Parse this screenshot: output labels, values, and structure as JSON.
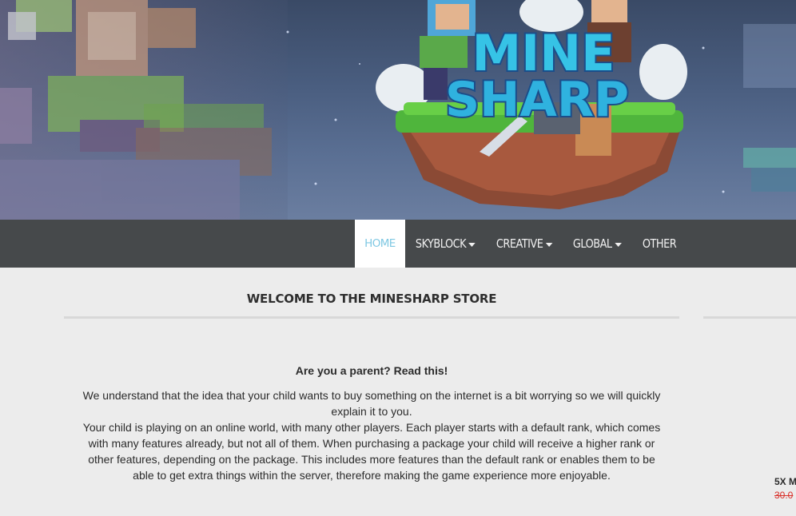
{
  "banner": {
    "logo_line1": "MINE",
    "logo_line2": "SHARP"
  },
  "nav": {
    "items": [
      {
        "label": "HOME",
        "active": true,
        "dropdown": false
      },
      {
        "label": "SKYBLOCK",
        "active": false,
        "dropdown": true
      },
      {
        "label": "CREATIVE",
        "active": false,
        "dropdown": true
      },
      {
        "label": "GLOBAL",
        "active": false,
        "dropdown": true
      },
      {
        "label": "OTHER",
        "active": false,
        "dropdown": false
      }
    ]
  },
  "main": {
    "title": "WELCOME TO THE MINESHARP STORE",
    "parent_heading": "Are you a parent? Read this!",
    "paragraph_1": "We understand that the idea that your child wants to buy something on the internet is a bit worrying so we will quickly explain it to you.",
    "paragraph_2": "Your child is playing on an online world, with many other players. Each player starts with a default rank, which comes with many features already, but not all of them. When purchasing a package your child will receive a higher rank or other features, depending on the package. This includes more features than the default rank or enables them to be able to get extra things within the server, therefore making the game experience more enjoyable."
  },
  "sidebar": {
    "package_name": "5X M",
    "package_old_price": "30.0"
  },
  "colors": {
    "nav_bg": "#46494b",
    "nav_active_text": "#7fc8e3",
    "page_bg": "#ececec",
    "old_price": "#d9302a"
  }
}
